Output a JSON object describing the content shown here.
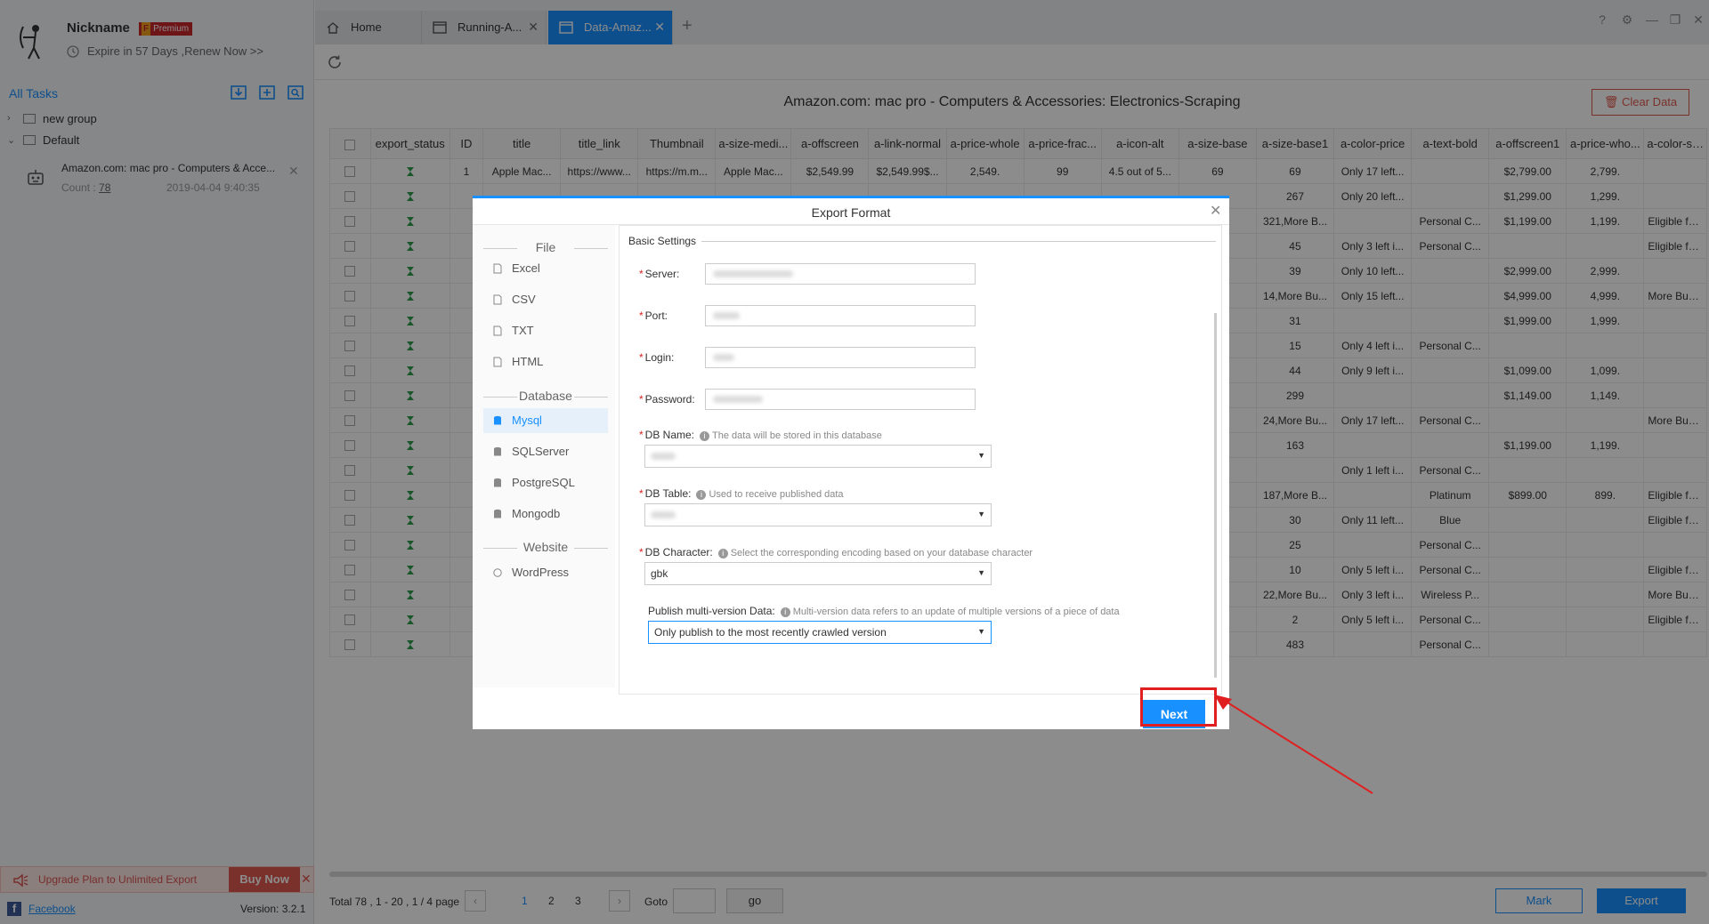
{
  "sidebar": {
    "nickname": "Nickname",
    "premium_badge": "F",
    "premium_label": "Premium",
    "expire": "Expire in 57 Days ,Renew Now >>",
    "all_tasks": "All Tasks",
    "groups": [
      {
        "label": "new group",
        "arrow": "›"
      },
      {
        "label": "Default",
        "arrow": "⌄"
      }
    ],
    "task": {
      "title": "Amazon.com: mac pro - Computers & Acce...",
      "count_label": "Count : ",
      "count_value": "78",
      "date": "2019-04-04 9:40:35"
    },
    "upgrade": "Upgrade Plan to Unlimited Export",
    "buy_now": "Buy Now",
    "facebook": "Facebook",
    "version": "Version: 3.2.1"
  },
  "tabs": [
    {
      "label": "Home"
    },
    {
      "label": "Running-A..."
    },
    {
      "label": "Data-Amaz..."
    }
  ],
  "main": {
    "title": "Amazon.com: mac pro - Computers & Accessories: Electronics-Scraping",
    "clear_data": "Clear Data"
  },
  "table": {
    "headers": [
      "export_status",
      "ID",
      "title",
      "title_link",
      "Thumbnail",
      "a-size-medi...",
      "a-offscreen",
      "a-link-normal",
      "a-price-whole",
      "a-price-frac...",
      "a-icon-alt",
      "a-size-base",
      "a-size-base1",
      "a-color-price",
      "a-text-bold",
      "a-offscreen1",
      "a-price-who...",
      "a-color-sec..."
    ],
    "rows": [
      [
        "1",
        "Apple Mac...",
        "https://www...",
        "https://m.m...",
        "Apple Mac...",
        "$2,549.99",
        "$2,549.99$...",
        "2,549.",
        "99",
        "4.5 out of 5...",
        "69",
        "69",
        "Only 17 left...",
        "",
        "$2,799.00",
        "2,799.",
        ""
      ],
      [
        "",
        "",
        "",
        "",
        "",
        "",
        "",
        "",
        "",
        "",
        "",
        "267",
        "Only 20 left...",
        "",
        "$1,299.00",
        "1,299.",
        ""
      ],
      [
        "",
        "",
        "",
        "",
        "",
        "",
        "",
        "",
        "",
        "",
        "",
        "321,More B...",
        "",
        "Personal C...",
        "$1,199.00",
        "1,199.",
        "Eligible for ..."
      ],
      [
        "",
        "",
        "",
        "",
        "",
        "",
        "",
        "",
        "",
        "",
        "",
        "45",
        "Only 3 left i...",
        "Personal C...",
        "",
        "",
        "Eligible for ..."
      ],
      [
        "",
        "",
        "",
        "",
        "",
        "",
        "",
        "",
        "",
        "",
        "",
        "39",
        "Only 10 left...",
        "",
        "$2,999.00",
        "2,999.",
        ""
      ],
      [
        "",
        "",
        "",
        "",
        "",
        "",
        "",
        "",
        "",
        "",
        "",
        "14,More Bu...",
        "Only 15 left...",
        "",
        "$4,999.00",
        "4,999.",
        "More Buyin..."
      ],
      [
        "",
        "",
        "",
        "",
        "",
        "",
        "",
        "",
        "",
        "",
        "",
        "31",
        "",
        "",
        "$1,999.00",
        "1,999.",
        ""
      ],
      [
        "",
        "",
        "",
        "",
        "",
        "",
        "",
        "",
        "",
        "",
        "",
        "15",
        "Only 4 left i...",
        "Personal C...",
        "",
        "",
        ""
      ],
      [
        "",
        "",
        "",
        "",
        "",
        "",
        "",
        "",
        "",
        "",
        "",
        "44",
        "Only 9 left i...",
        "",
        "$1,099.00",
        "1,099.",
        ""
      ],
      [
        "",
        "",
        "",
        "",
        "",
        "",
        "",
        "",
        "",
        "",
        "",
        "299",
        "",
        "",
        "$1,149.00",
        "1,149.",
        ""
      ],
      [
        "",
        "",
        "",
        "",
        "",
        "",
        "",
        "",
        "",
        "",
        "",
        "24,More Bu...",
        "Only 17 left...",
        "Personal C...",
        "",
        "",
        "More Buyin..."
      ],
      [
        "",
        "",
        "",
        "",
        "",
        "",
        "",
        "",
        "",
        "",
        "",
        "163",
        "",
        "",
        "$1,199.00",
        "1,199.",
        ""
      ],
      [
        "",
        "",
        "",
        "",
        "",
        "",
        "",
        "",
        "",
        "",
        "",
        "",
        "Only 1 left i...",
        "Personal C...",
        "",
        "",
        ""
      ],
      [
        "",
        "",
        "",
        "",
        "",
        "",
        "",
        "",
        "",
        "",
        "",
        "187,More B...",
        "",
        "Platinum",
        "$899.00",
        "899.",
        "Eligible for ..."
      ],
      [
        "",
        "",
        "",
        "",
        "",
        "",
        "",
        "",
        "",
        "",
        "",
        "30",
        "Only 11 left...",
        "Blue",
        "",
        "",
        "Eligible for ..."
      ],
      [
        "",
        "",
        "",
        "",
        "",
        "",
        "",
        "",
        "",
        "",
        "",
        "25",
        "",
        "Personal C...",
        "",
        "",
        ""
      ],
      [
        "",
        "",
        "",
        "",
        "",
        "",
        "",
        "",
        "",
        "",
        "",
        "10",
        "Only 5 left i...",
        "Personal C...",
        "",
        "",
        "Eligible for ..."
      ],
      [
        "",
        "",
        "",
        "",
        "",
        "",
        "",
        "",
        "",
        "",
        "",
        "22,More Bu...",
        "Only 3 left i...",
        "Wireless P...",
        "",
        "",
        "More Buyin..."
      ],
      [
        "",
        "",
        "",
        "",
        "",
        "",
        "",
        "",
        "",
        "",
        "",
        "2",
        "Only 5 left i...",
        "Personal C...",
        "",
        "",
        "Eligible for ..."
      ],
      [
        "",
        "",
        "",
        "",
        "",
        "",
        "",
        "",
        "",
        "",
        "",
        "483",
        "",
        "Personal C...",
        "",
        "",
        ""
      ]
    ]
  },
  "pager": {
    "total": "Total  78  ,  1  - 20 ,  1  /  4   page",
    "pages": [
      "1",
      "2",
      "3"
    ],
    "goto": "Goto",
    "go": "go",
    "mark": "Mark",
    "export": "Export"
  },
  "dialog": {
    "title": "Export Format",
    "sections": {
      "file": "File",
      "database": "Database",
      "website": "Website"
    },
    "file_items": [
      "Excel",
      "CSV",
      "TXT",
      "HTML"
    ],
    "db_items": [
      "Mysql",
      "SQLServer",
      "PostgreSQL",
      "Mongodb"
    ],
    "web_items": [
      "WordPress"
    ],
    "basic_settings": "Basic Settings",
    "fields": {
      "server": "Server:",
      "port": "Port:",
      "login": "Login:",
      "password": "Password:",
      "db_name": "DB Name:",
      "db_name_hint": "The data will be stored in this database",
      "db_table": "DB Table:",
      "db_table_hint": "Used to receive published data",
      "db_char": "DB Character:",
      "db_char_hint": "Select the corresponding encoding based on your database character",
      "db_char_value": "gbk",
      "multi": "Publish multi-version Data:",
      "multi_hint": "Multi-version data refers to an update of multiple versions of a piece of data",
      "multi_value": "Only publish to the most recently crawled version"
    },
    "next": "Next"
  },
  "colors": {
    "accent": "#1890ff",
    "danger": "#e02020"
  }
}
